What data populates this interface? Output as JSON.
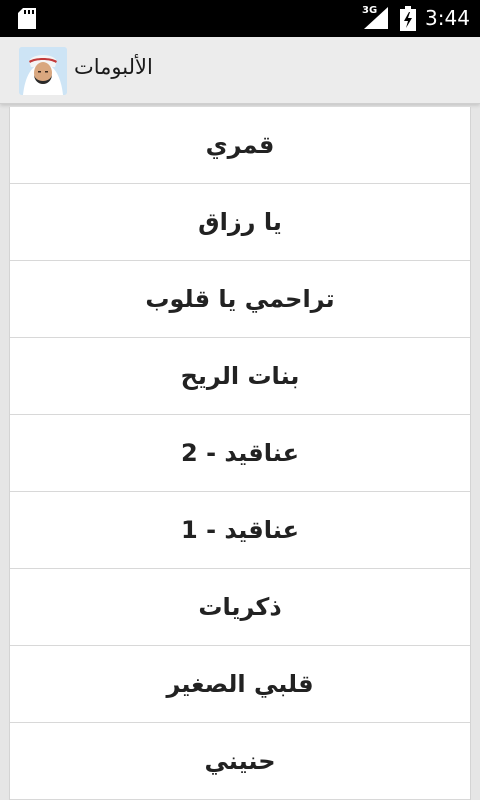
{
  "status_bar": {
    "network_type": "3G",
    "time": "3:44"
  },
  "action_bar": {
    "title": "الألبومات",
    "avatar_icon": "reciter-avatar"
  },
  "albums": [
    {
      "label": "قمري"
    },
    {
      "label": "يا رزاق"
    },
    {
      "label": "تراحمي يا قلوب"
    },
    {
      "label": "بنات الريح"
    },
    {
      "label": "عناقيد - 2"
    },
    {
      "label": "عناقيد - 1"
    },
    {
      "label": "ذكريات"
    },
    {
      "label": "قلبي الصغير"
    },
    {
      "label": "حنيني"
    }
  ],
  "colors": {
    "status_bar_bg": "#000000",
    "action_bar_bg": "#ececec",
    "list_bg": "#ffffff",
    "page_bg": "#e6e6e6",
    "divider": "#d8d8d8"
  }
}
